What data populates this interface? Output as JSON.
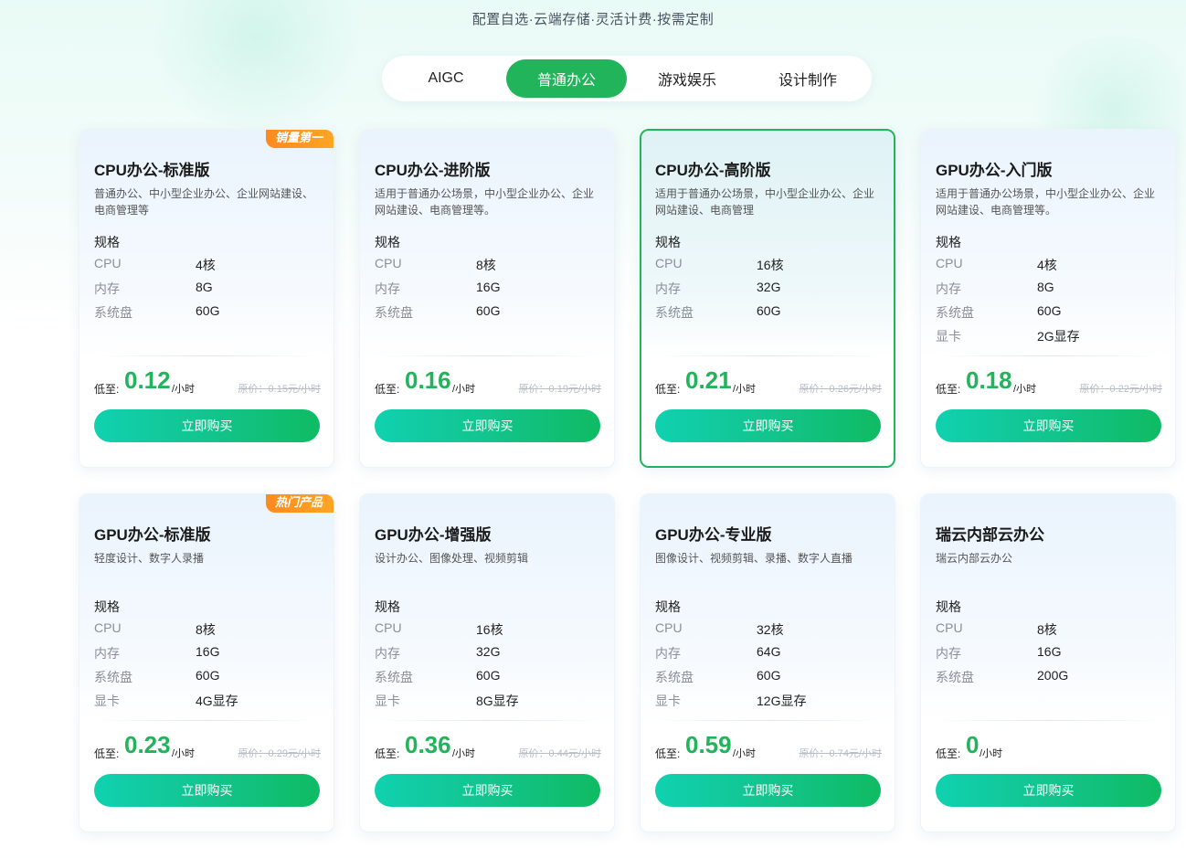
{
  "subtitle": "配置自选·云端存储·灵活计费·按需定制",
  "tabs": [
    {
      "label": "AIGC",
      "active": false
    },
    {
      "label": "普通办公",
      "active": true
    },
    {
      "label": "游戏娱乐",
      "active": false
    },
    {
      "label": "设计制作",
      "active": false
    }
  ],
  "spec_header": "规格",
  "price_prefix": "低至:",
  "price_unit": "/小时",
  "buy_label": "立即购买",
  "accent_color": "#21b45b",
  "badge_color": "#ff8a1f",
  "cards": [
    {
      "title": "CPU办公-标准版",
      "badge": "销量第一",
      "desc": "普通办公、中小型企业办公、企业网站建设、电商管理等",
      "specs": [
        {
          "k": "CPU",
          "v": "4核"
        },
        {
          "k": "内存",
          "v": "8G"
        },
        {
          "k": "系统盘",
          "v": "60G"
        }
      ],
      "price": "0.12",
      "original": "原价：0.15元/小时"
    },
    {
      "title": "CPU办公-进阶版",
      "desc": "适用于普通办公场景，中小型企业办公、企业网站建设、电商管理等。",
      "specs": [
        {
          "k": "CPU",
          "v": "8核"
        },
        {
          "k": "内存",
          "v": "16G"
        },
        {
          "k": "系统盘",
          "v": "60G"
        }
      ],
      "price": "0.16",
      "original": "原价：0.19元/小时"
    },
    {
      "title": "CPU办公-高阶版",
      "selected": true,
      "desc": "适用于普通办公场景，中小型企业办公、企业网站建设、电商管理",
      "specs": [
        {
          "k": "CPU",
          "v": "16核"
        },
        {
          "k": "内存",
          "v": "32G"
        },
        {
          "k": "系统盘",
          "v": "60G"
        }
      ],
      "price": "0.21",
      "original": "原价：0.26元/小时"
    },
    {
      "title": "GPU办公-入门版",
      "desc": "适用于普通办公场景，中小型企业办公、企业网站建设、电商管理等。",
      "specs": [
        {
          "k": "CPU",
          "v": "4核"
        },
        {
          "k": "内存",
          "v": "8G"
        },
        {
          "k": "系统盘",
          "v": "60G"
        },
        {
          "k": "显卡",
          "v": "2G显存"
        }
      ],
      "price": "0.18",
      "original": "原价：0.22元/小时"
    },
    {
      "title": "GPU办公-标准版",
      "badge": "热门产品",
      "desc": "轻度设计、数字人录播",
      "specs": [
        {
          "k": "CPU",
          "v": "8核"
        },
        {
          "k": "内存",
          "v": "16G"
        },
        {
          "k": "系统盘",
          "v": "60G"
        },
        {
          "k": "显卡",
          "v": "4G显存"
        }
      ],
      "price": "0.23",
      "original": "原价：0.29元/小时"
    },
    {
      "title": "GPU办公-增强版",
      "desc": "设计办公、图像处理、视频剪辑",
      "specs": [
        {
          "k": "CPU",
          "v": "16核"
        },
        {
          "k": "内存",
          "v": "32G"
        },
        {
          "k": "系统盘",
          "v": "60G"
        },
        {
          "k": "显卡",
          "v": "8G显存"
        }
      ],
      "price": "0.36",
      "original": "原价：0.44元/小时"
    },
    {
      "title": "GPU办公-专业版",
      "desc": "图像设计、视频剪辑、录播、数字人直播",
      "specs": [
        {
          "k": "CPU",
          "v": "32核"
        },
        {
          "k": "内存",
          "v": "64G"
        },
        {
          "k": "系统盘",
          "v": "60G"
        },
        {
          "k": "显卡",
          "v": "12G显存"
        }
      ],
      "price": "0.59",
      "original": "原价：0.74元/小时"
    },
    {
      "title": "瑞云内部云办公",
      "desc": "瑞云内部云办公",
      "specs": [
        {
          "k": "CPU",
          "v": "8核"
        },
        {
          "k": "内存",
          "v": "16G"
        },
        {
          "k": "系统盘",
          "v": "200G"
        }
      ],
      "price": "0",
      "original": ""
    }
  ]
}
